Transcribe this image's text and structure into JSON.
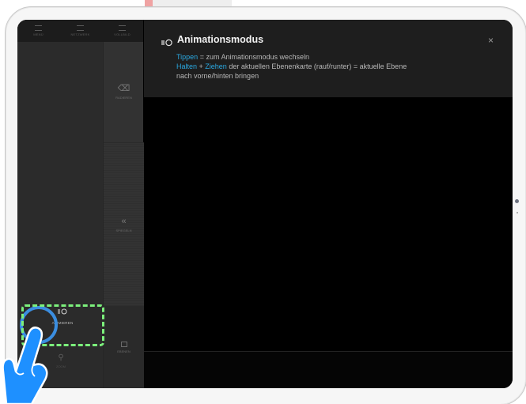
{
  "sidebar": {
    "top_tabs": [
      {
        "label": "MENÜ"
      },
      {
        "label": "NETZWERK"
      },
      {
        "label": "VOLLBILD"
      }
    ],
    "tools": {
      "erase_label": "RADIEREN",
      "move_label": "SPIEGELN",
      "layer_label": "EBENEN"
    },
    "animate_label": "ANIMIEREN",
    "zoom_label": "ZOOM"
  },
  "popup": {
    "title": "Animationsmodus",
    "close_symbol": "×",
    "line1_link": "Tippen",
    "line1_rest": " = zum Animationsmodus wechseln",
    "line2_link1": "Halten",
    "line2_plus": " + ",
    "line2_link2": "Ziehen",
    "line2_rest": " der aktuellen Ebenenkarte (rauf/runter) = aktuelle Ebene",
    "line3": "nach vorne/hinten bringen"
  },
  "icons": {
    "animate": "animation-mode-icon",
    "erase": "eraser-icon",
    "move": "double-chevron-left-icon",
    "layer": "layer-square-icon",
    "zoom": "magnifier-icon",
    "close": "close-icon"
  },
  "colors": {
    "link_blue": "#2aa8e0",
    "highlight_green": "#7cf07c",
    "touch_ring_blue": "#3b8ee0",
    "hand_blue": "#1e90ff"
  }
}
